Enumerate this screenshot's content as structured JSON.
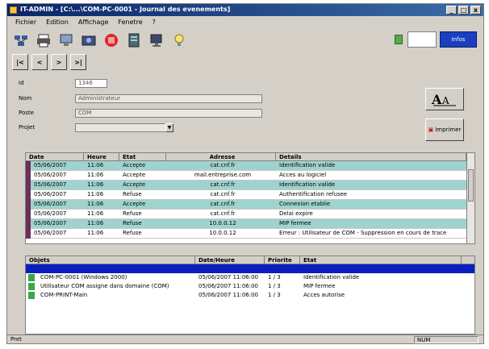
{
  "window": {
    "title": "IT-ADMIN - [C:\\...\\COM-PC-0001 - Journal des evenements]",
    "min": "_",
    "max": "□",
    "close": "x"
  },
  "menu": {
    "items": [
      "Fichier",
      "Edition",
      "Affichage",
      "Fenetre",
      "?"
    ]
  },
  "toolbar": {
    "icons": [
      "network-icon",
      "printer-icon",
      "computer-icon",
      "scan-icon",
      "stop-icon",
      "server-icon",
      "monitor-icon",
      "bulb-icon"
    ],
    "info_label": "Infos"
  },
  "nav": {
    "first": "|<",
    "prev": "<",
    "next": ">",
    "last": ">|"
  },
  "form": {
    "id_label": "Id",
    "id_value": "1346",
    "user_label": "Nom",
    "user_value": "Administrateur",
    "program_label": "Poste",
    "program_value": "COM",
    "project_label": "Projet",
    "project_value": "",
    "print_label": "Imprimer",
    "colors": {
      "accent_blue": "#1a3fbf",
      "row_teal": "#9fd3cd",
      "row_mark": "#6a2f5a",
      "selected": "#0a1ec0"
    }
  },
  "table1": {
    "columns": [
      "Date",
      "Heure",
      "Etat",
      "Adresse",
      "Details"
    ],
    "rows": [
      {
        "date": "05/06/2007",
        "time": "11:06",
        "status": "Accepte",
        "address": "cat.cnf.fr",
        "detail": "Identification valide"
      },
      {
        "date": "05/06/2007",
        "time": "11:06",
        "status": "Accepte",
        "address": "mail.entreprise.com",
        "detail": "Acces au logiciel"
      },
      {
        "date": "05/06/2007",
        "time": "11:06",
        "status": "Accepte",
        "address": "cat.cnf.fr",
        "detail": "Identification valide"
      },
      {
        "date": "05/06/2007",
        "time": "11:06",
        "status": "Refuse",
        "address": "cat.cnf.fr",
        "detail": "Authentification refusee"
      },
      {
        "date": "05/06/2007",
        "time": "11:06",
        "status": "Accepte",
        "address": "cat.cnf.fr",
        "detail": "Connexion etablie"
      },
      {
        "date": "05/06/2007",
        "time": "11:06",
        "status": "Refuse",
        "address": "cat.cnf.fr",
        "detail": "Delai expire"
      },
      {
        "date": "05/06/2007",
        "time": "11:06",
        "status": "Refuse",
        "address": "10.0.0.12",
        "detail": "MIP fermee"
      },
      {
        "date": "05/06/2007",
        "time": "11:06",
        "status": "Refuse",
        "address": "10.0.0.12",
        "detail": "Erreur : Utilisateur de COM - Suppression en cours de trace"
      }
    ]
  },
  "table2": {
    "columns": [
      "Objets",
      "Date/Heure",
      "Priorite",
      "Etat"
    ],
    "rows": [
      {
        "name": "",
        "datetime": "",
        "priority": "",
        "state": ""
      },
      {
        "name": "COM-PC-0001 (Windows 2000)",
        "datetime": "05/06/2007 11:06:00",
        "priority": "1 / 3",
        "state": "Identification valide"
      },
      {
        "name": "Utilisateur COM assigne dans domaine (COM)",
        "datetime": "05/06/2007 11:06:00",
        "priority": "1 / 3",
        "state": "MIP fermee"
      },
      {
        "name": "COM-PRINT-Main",
        "datetime": "05/06/2007 11:06:00",
        "priority": "1 / 3",
        "state": "Acces autorise"
      }
    ]
  },
  "status": {
    "left": "Pret",
    "right": "NUM"
  }
}
